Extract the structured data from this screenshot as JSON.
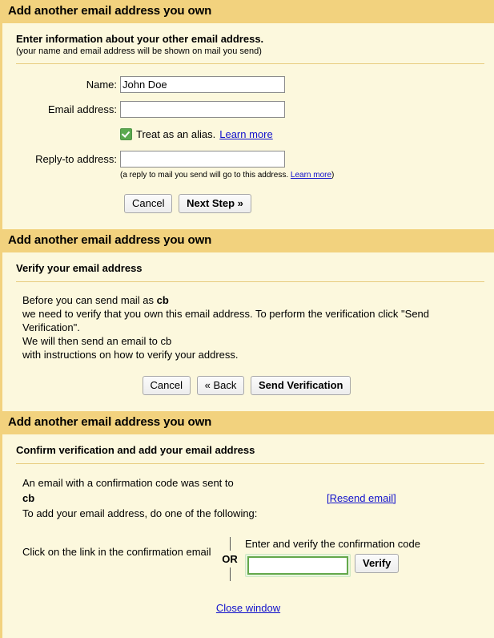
{
  "panels": [
    {
      "header": "Add another email address you own",
      "section_title": "Enter information about your other email address.",
      "section_sub": "(your name and email address will be shown on mail you send)",
      "fields": {
        "name_label": "Name:",
        "name_value": "John Doe",
        "email_label": "Email address:",
        "email_value": "",
        "alias_label": "Treat as an alias.",
        "alias_learn_more": "Learn more",
        "alias_checked": true,
        "replyto_label": "Reply-to address:",
        "replyto_value": "",
        "replyto_hint_prefix": "(a reply to mail you send will go to this address. ",
        "replyto_hint_link": "Learn more",
        "replyto_hint_suffix": ")"
      },
      "buttons": {
        "cancel": "Cancel",
        "next": "Next Step »"
      }
    },
    {
      "header": "Add another email address you own",
      "section_title": "Verify your email address",
      "body_line1_prefix": "Before you can send mail as ",
      "body_line1_bold": "cb",
      "body_line2": "we need to verify that you own this email address. To perform the verification click \"Send Verification\".",
      "body_line3": "We will then send an email to cb",
      "body_line4": "with instructions on how to verify your address.",
      "buttons": {
        "cancel": "Cancel",
        "back": "« Back",
        "send": "Send Verification"
      }
    },
    {
      "header": "Add another email address you own",
      "section_title": "Confirm verification and add your email address",
      "sent_line": "An email with a confirmation code was sent to",
      "sent_address": "cb",
      "instruction_line": "To add your email address, do one of the following:",
      "resend_link": "[Resend email]",
      "option_left": "Click on the link in the confirmation email",
      "or_label": "OR",
      "option_right_label": "Enter and verify the confirmation code",
      "code_value": "",
      "verify_button": "Verify",
      "close_window": "Close window"
    }
  ],
  "colors": {
    "header_bg": "#f2d27e",
    "body_bg": "#fcf8dd",
    "rule": "#e8cd80",
    "link": "#1111cc",
    "checkbox_green": "#5aa94f",
    "code_border_green": "#64a84b"
  }
}
